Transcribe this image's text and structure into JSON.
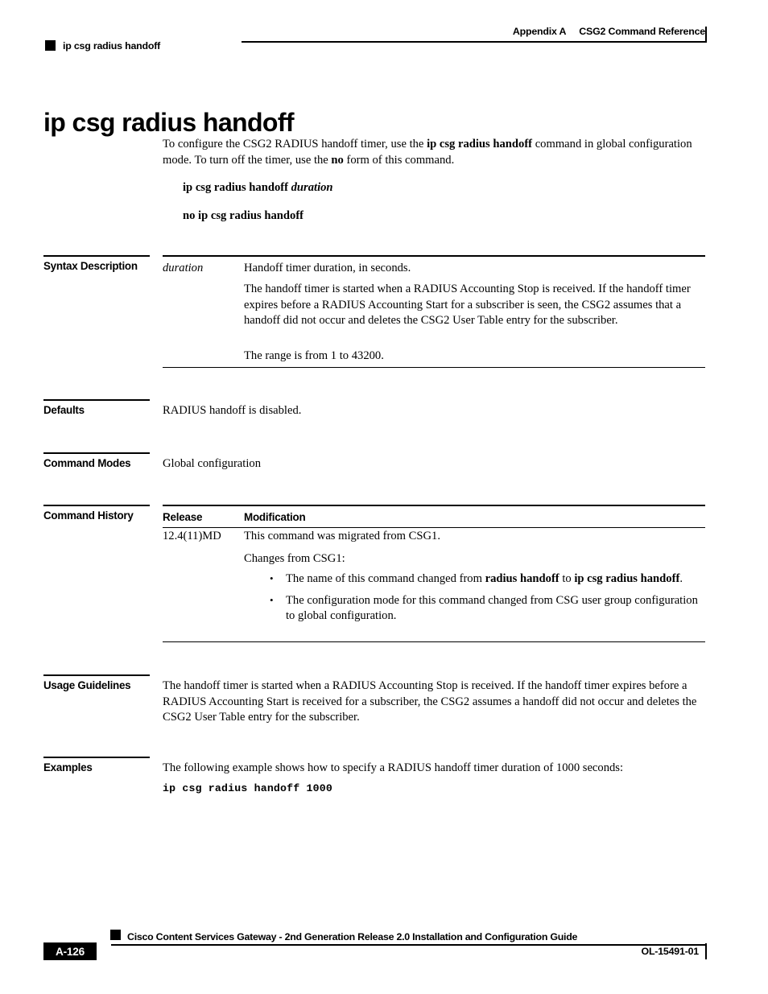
{
  "header": {
    "appendix": "Appendix A",
    "chapter": "CSG2 Command Reference",
    "running_head": "ip csg radius handoff",
    "bullet_icon": "black-square-icon"
  },
  "title": "ip csg radius handoff",
  "intro": {
    "part1": "To configure the CSG2 RADIUS handoff timer, use the ",
    "command_bold": "ip csg radius handoff",
    "part2": " command in global configuration mode. To turn off the timer, use the ",
    "no_bold": "no",
    "part3": " form of this command."
  },
  "syntax_lines": {
    "positive_command": "ip csg radius handoff ",
    "positive_argument": "duration",
    "negative_command": "no ip csg radius handoff"
  },
  "sections": {
    "syntax_description": {
      "label": "Syntax Description",
      "rows": [
        {
          "term": "duration",
          "paragraphs": [
            "Handoff timer duration, in seconds.",
            "The handoff timer is started when a RADIUS Accounting Stop is received. If the handoff timer expires before a RADIUS Accounting Start for a subscriber is seen, the CSG2 assumes that a handoff did not occur and deletes the CSG2 User Table entry for the subscriber.",
            "The range is from 1 to 43200."
          ]
        }
      ]
    },
    "defaults": {
      "label": "Defaults",
      "text": "RADIUS handoff is disabled."
    },
    "command_modes": {
      "label": "Command Modes",
      "text": "Global configuration"
    },
    "command_history": {
      "label": "Command History",
      "columns": [
        "Release",
        "Modification"
      ],
      "release": "12.4(11)MD",
      "modification_lines": [
        "This command was migrated from CSG1.",
        "Changes from CSG1:"
      ],
      "bullets": [
        {
          "pre": "The name of this command changed from ",
          "bold1": "radius handoff",
          "mid": " to ",
          "bold2": "ip csg radius handoff",
          "post": "."
        },
        {
          "pre": "The configuration mode for this command changed from CSG user group configuration to global configuration.",
          "bold1": "",
          "mid": "",
          "bold2": "",
          "post": ""
        }
      ]
    },
    "usage_guidelines": {
      "label": "Usage Guidelines",
      "text": "The handoff timer is started when a RADIUS Accounting Stop is received. If the handoff timer expires before a RADIUS Accounting Start is received for a subscriber, the CSG2 assumes a handoff did not occur and deletes the CSG2 User Table entry for the subscriber."
    },
    "examples": {
      "label": "Examples",
      "text": "The following example shows how to specify a RADIUS handoff timer duration of 1000 seconds:",
      "code": "ip csg radius handoff 1000"
    }
  },
  "footer": {
    "guide_title": "Cisco Content Services Gateway - 2nd Generation Release 2.0 Installation and Configuration Guide",
    "page_number": "A-126",
    "doc_id": "OL-15491-01",
    "bullet_icon": "black-square-icon"
  },
  "colors": {
    "ink": "#000000",
    "paper": "#ffffff"
  }
}
